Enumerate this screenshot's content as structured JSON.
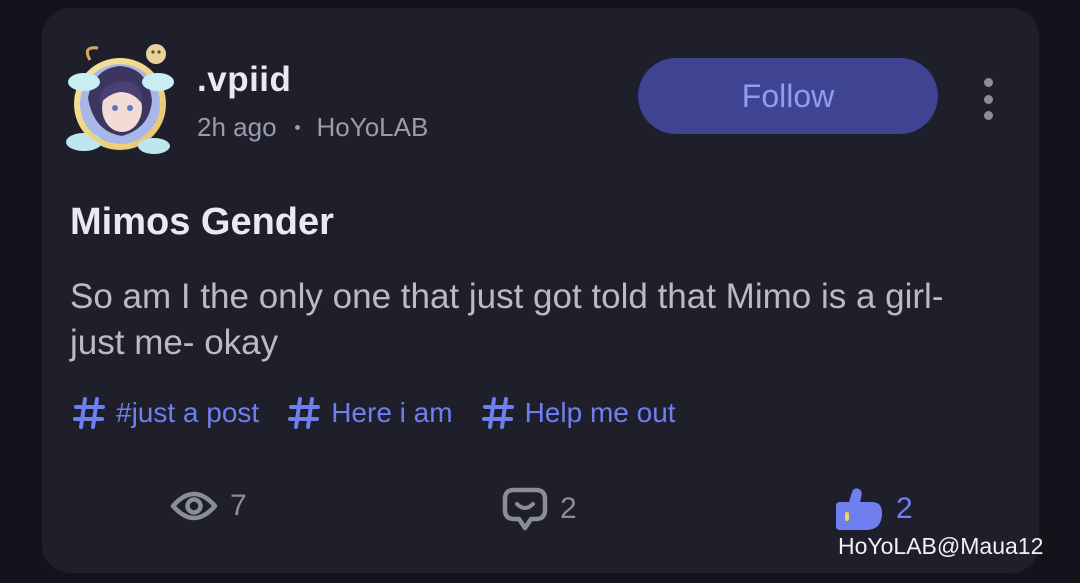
{
  "post": {
    "author": {
      "username": ".vpiid",
      "time_ago": "2h ago",
      "source": "HoYoLAB"
    },
    "follow_label": "Follow",
    "title": "Mimos Gender",
    "body": "So am I the only one that just got told that Mimo is a girl- just me- okay",
    "tags": [
      "#just a post",
      "Here i am",
      "Help me out"
    ],
    "stats": {
      "views": "7",
      "comments": "2",
      "likes": "2"
    }
  },
  "watermark": "HoYoLAB@Maua12",
  "colors": {
    "background": "#13131c",
    "card": "#1e1f2b",
    "accent": "#6f7ff0",
    "follow_bg": "#3e4392"
  },
  "icons": {
    "more": "kebab-menu-icon",
    "tag": "hashtag-icon",
    "views": "eye-icon",
    "comments": "comment-bubble-icon",
    "likes": "thumbs-up-icon"
  }
}
